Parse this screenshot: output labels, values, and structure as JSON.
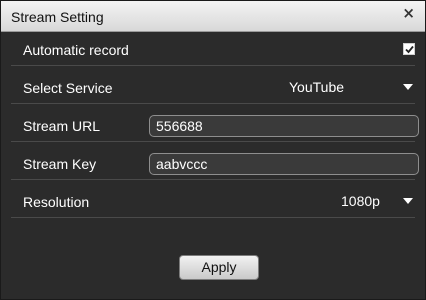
{
  "window": {
    "title": "Stream Setting",
    "close_glyph": "×"
  },
  "automatic_record": {
    "label": "Automatic record",
    "checked": true
  },
  "service": {
    "label": "Select Service",
    "value": "YouTube"
  },
  "stream_url": {
    "label": "Stream URL",
    "value": "556688"
  },
  "stream_key": {
    "label": "Stream Key",
    "value": "aabvccc"
  },
  "resolution": {
    "label": "Resolution",
    "value": "1080p"
  },
  "apply": {
    "label": "Apply"
  },
  "colors": {
    "background": "#2b2b2b",
    "titlebar": "#e6e6e6",
    "text": "#ffffff"
  }
}
